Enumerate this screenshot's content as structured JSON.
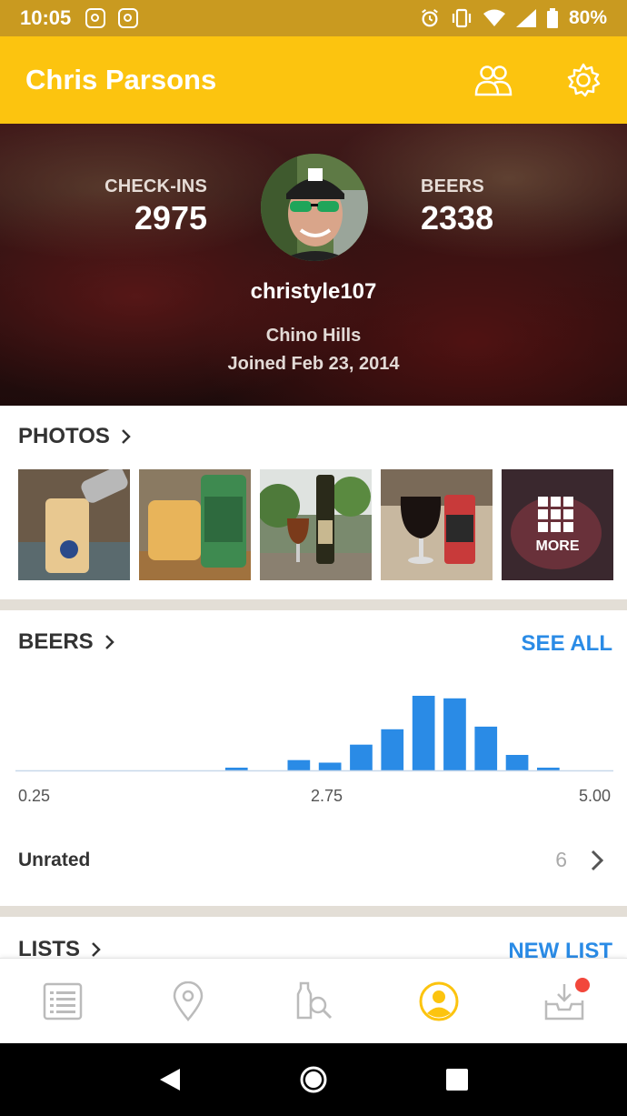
{
  "status_bar": {
    "time": "10:05",
    "battery": "80%"
  },
  "app_bar": {
    "title": "Chris Parsons",
    "icons": [
      "friends-icon",
      "settings-icon"
    ]
  },
  "profile": {
    "checkins_label": "CHECK-INS",
    "checkins_value": "2975",
    "beers_label": "BEERS",
    "beers_value": "2338",
    "username": "christyle107",
    "location": "Chino Hills",
    "joined": "Joined Feb 23, 2014"
  },
  "photos": {
    "title": "PHOTOS",
    "more_label": "MORE",
    "count_shown": 5
  },
  "beers_section": {
    "title": "BEERS",
    "see_all": "SEE ALL",
    "chart_data": {
      "type": "bar",
      "x": [
        0.25,
        0.5,
        0.75,
        1.0,
        1.25,
        1.5,
        1.75,
        2.0,
        2.25,
        2.5,
        2.75,
        3.0,
        3.25,
        3.5,
        3.75,
        4.0,
        4.25,
        4.5,
        4.75,
        5.0
      ],
      "values": [
        0,
        0,
        0,
        0,
        0,
        0,
        0,
        1,
        0,
        4,
        3,
        10,
        16,
        29,
        28,
        17,
        6,
        1,
        0,
        0
      ],
      "xlim": [
        0.25,
        5.0
      ],
      "tick_labels": [
        "0.25",
        "2.75",
        "5.00"
      ],
      "bar_color": "#2a8be6"
    },
    "unrated_label": "Unrated",
    "unrated_count": "6"
  },
  "lists_section": {
    "title": "LISTS",
    "new_list": "NEW LIST"
  },
  "bottom_nav": {
    "items": [
      "feed-icon",
      "location-icon",
      "beer-search-icon",
      "profile-icon",
      "inbox-icon"
    ],
    "active": "profile-icon",
    "accent": "#fcc40f"
  },
  "colors": {
    "app_bar": "#fcc40f",
    "status_bar": "#c99a20",
    "link_blue": "#2a8be6"
  }
}
